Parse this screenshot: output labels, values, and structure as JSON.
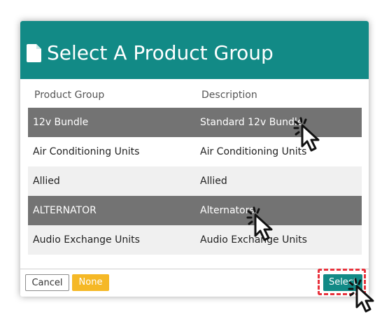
{
  "dialog": {
    "title": "Select A Product Group",
    "icon": "document-icon",
    "header_color": "#128a86"
  },
  "table": {
    "columns": [
      "Product Group",
      "Description"
    ],
    "rows": [
      {
        "group": "12v Bundle",
        "description": "Standard 12v Bundle",
        "selected": true
      },
      {
        "group": "Air Conditioning Units",
        "description": "Air Conditioning Units",
        "selected": false
      },
      {
        "group": "Allied",
        "description": "Allied",
        "selected": false
      },
      {
        "group": "ALTERNATOR",
        "description": "Alternators",
        "selected": true
      },
      {
        "group": "Audio Exchange Units",
        "description": "Audio Exchange Units",
        "selected": false
      }
    ],
    "selected_row_color": "#737373",
    "stripe_color": "#f0f0f0"
  },
  "footer": {
    "cancel_label": "Cancel",
    "none_label": "None",
    "select_label": "Select",
    "none_color": "#f5b826",
    "select_color": "#128a86",
    "highlight_color": "#e8323c"
  },
  "cursors": [
    "click-cursor-icon",
    "click-cursor-icon",
    "click-cursor-icon"
  ]
}
